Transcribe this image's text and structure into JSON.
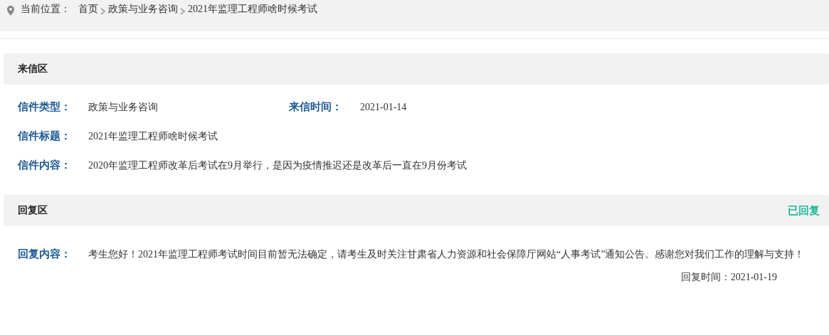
{
  "breadcrumb": {
    "label": "当前位置：",
    "items": [
      "首页",
      "政策与业务咨询",
      "2021年监理工程师啥时候考试"
    ]
  },
  "letter": {
    "title": "来信区",
    "type": {
      "label": "信件类型：",
      "value": "政策与业务咨询"
    },
    "time": {
      "label": "来信时间：",
      "value": "2021-01-14"
    },
    "subject": {
      "label": "信件标题：",
      "value": "2021年监理工程师啥时候考试"
    },
    "content": {
      "label": "信件内容：",
      "value": "2020年监理工程师改革后考试在9月举行，是因为疫情推迟还是改革后一直在9月份考试"
    }
  },
  "reply": {
    "title": "回复区",
    "status": "已回复",
    "replied": true,
    "content": {
      "label": "回复内容：",
      "value": "考生您好！2021年监理工程师考试时间目前暂无法确定，请考生及时关注甘肃省人力资源和社会保障厅网站“人事考试”通知公告。感谢您对我们工作的理解与支持！"
    },
    "time": {
      "label": "回复时间：",
      "value": "2021-01-19"
    }
  }
}
